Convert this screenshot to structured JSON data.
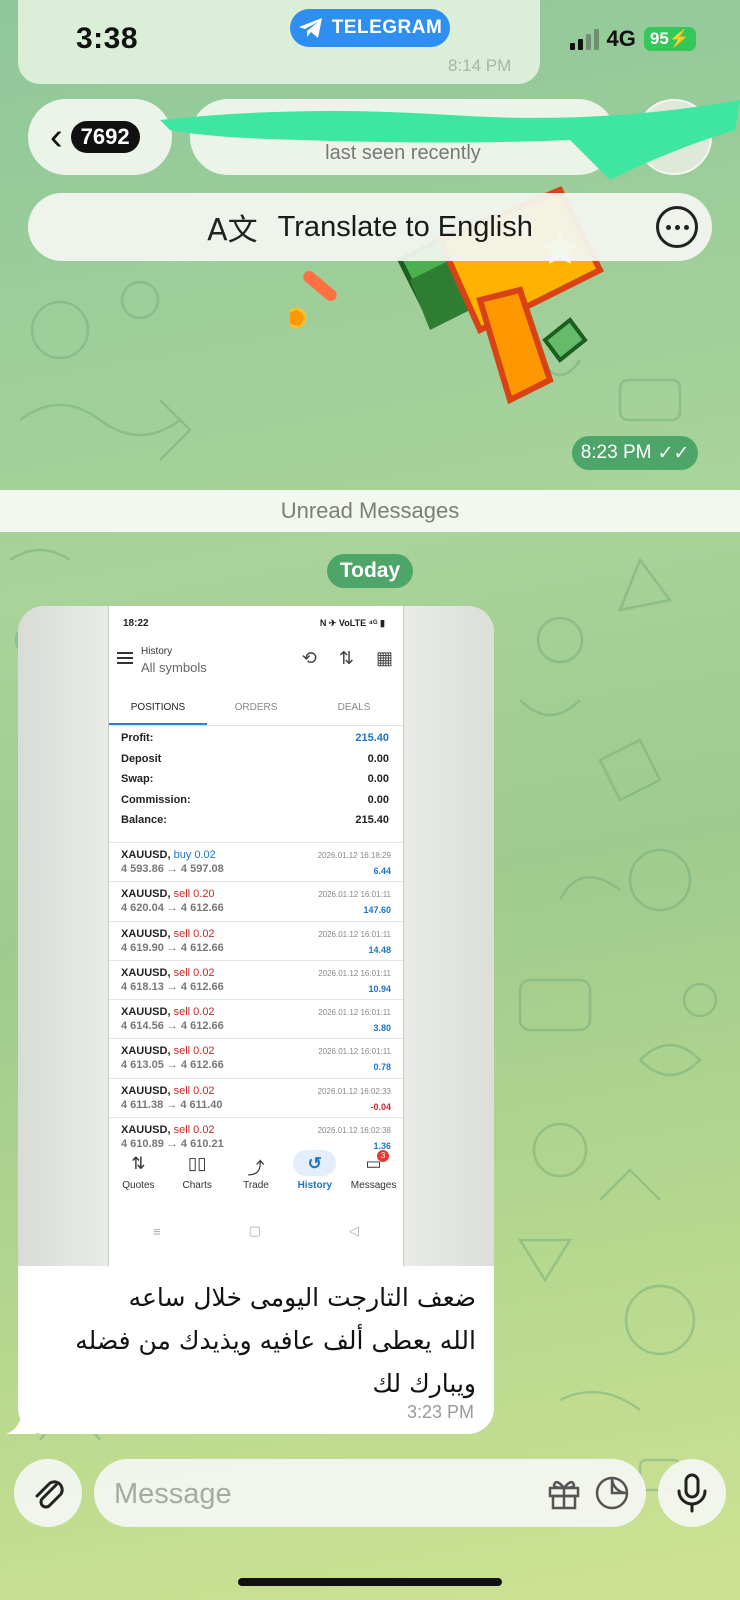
{
  "status_bar": {
    "time": "3:38",
    "app_pill": "TELEGRAM",
    "network": "4G",
    "battery": "95"
  },
  "previous_message": {
    "time": "8:14 PM"
  },
  "header": {
    "back_icon": "chevron-left-icon",
    "unread_count": "7692",
    "subtitle": "last seen recently"
  },
  "translate_bar": {
    "icon": "translate-icon",
    "label": "Translate to English",
    "more_icon": "more-icon"
  },
  "sticker_message": {
    "time": "8:23 PM",
    "read_icon": "double-check-icon"
  },
  "unread_divider": "Unread Messages",
  "date_divider": "Today",
  "photo": {
    "status_time": "18:22",
    "status_right": "N ✈ VoLTE ⁴ᴳ ▮",
    "title": "History",
    "subtitle": "All symbols",
    "tabs": [
      "POSITIONS",
      "ORDERS",
      "DEALS"
    ],
    "summary": [
      {
        "label": "Profit:",
        "value": "215.40"
      },
      {
        "label": "Deposit",
        "value": "0.00"
      },
      {
        "label": "Swap:",
        "value": "0.00"
      },
      {
        "label": "Commission:",
        "value": "0.00"
      },
      {
        "label": "Balance:",
        "value": "215.40"
      }
    ],
    "deals": [
      {
        "symbol": "XAUUSD,",
        "side": "buy 0.02",
        "type": "buy",
        "prices": "4 593.86 → 4 597.08",
        "datetime": "2026.01.12 16:18:29",
        "pl": "6.44"
      },
      {
        "symbol": "XAUUSD,",
        "side": "sell 0.20",
        "type": "sell",
        "prices": "4 620.04 → 4 612.66",
        "datetime": "2026.01.12 16:01:11",
        "pl": "147.60"
      },
      {
        "symbol": "XAUUSD,",
        "side": "sell 0.02",
        "type": "sell",
        "prices": "4 619.90 → 4 612.66",
        "datetime": "2026.01.12 16:01:11",
        "pl": "14.48"
      },
      {
        "symbol": "XAUUSD,",
        "side": "sell 0.02",
        "type": "sell",
        "prices": "4 618.13 → 4 612.66",
        "datetime": "2026.01.12 16:01:11",
        "pl": "10.94"
      },
      {
        "symbol": "XAUUSD,",
        "side": "sell 0.02",
        "type": "sell",
        "prices": "4 614.56 → 4 612.66",
        "datetime": "2026.01.12 16:01:11",
        "pl": "3.80"
      },
      {
        "symbol": "XAUUSD,",
        "side": "sell 0.02",
        "type": "sell",
        "prices": "4 613.05 → 4 612.66",
        "datetime": "2026.01.12 16:01:11",
        "pl": "0.78"
      },
      {
        "symbol": "XAUUSD,",
        "side": "sell 0.02",
        "type": "sell",
        "prices": "4 611.38 → 4 611.40",
        "datetime": "2026.01.12 16:02:33",
        "pl": "-0.04"
      },
      {
        "symbol": "XAUUSD,",
        "side": "sell 0.02",
        "type": "sell",
        "prices": "4 610.89 → 4 610.21",
        "datetime": "2026.01.12 16:02:38",
        "pl": "1.36"
      }
    ],
    "nav": [
      {
        "label": "Quotes",
        "icon": "quotes-icon",
        "glyph": "⇅"
      },
      {
        "label": "Charts",
        "icon": "charts-icon",
        "glyph": "▯▯"
      },
      {
        "label": "Trade",
        "icon": "trade-icon",
        "glyph": "⤴"
      },
      {
        "label": "History",
        "icon": "history-icon",
        "glyph": "↺"
      },
      {
        "label": "Messages",
        "icon": "messages-icon",
        "glyph": "▭",
        "badge": "3"
      }
    ],
    "active_nav": "History"
  },
  "message": {
    "lines": [
      "ضعف التارجت اليومى خلال ساعه",
      "الله يعطى ألف عافيه ويذيدك من فضله",
      "ويبارك لك"
    ],
    "time": "3:23 PM"
  },
  "composer": {
    "placeholder": "Message",
    "attach_icon": "paperclip-icon",
    "gift_icon": "gift-icon",
    "sticker_icon": "sticker-icon",
    "mic_icon": "microphone-icon"
  },
  "colors": {
    "accent_green": "#4ea56a",
    "telegram_blue": "#2f8ff0",
    "profit_blue": "#1f74c4",
    "sell_red": "#c62828"
  }
}
